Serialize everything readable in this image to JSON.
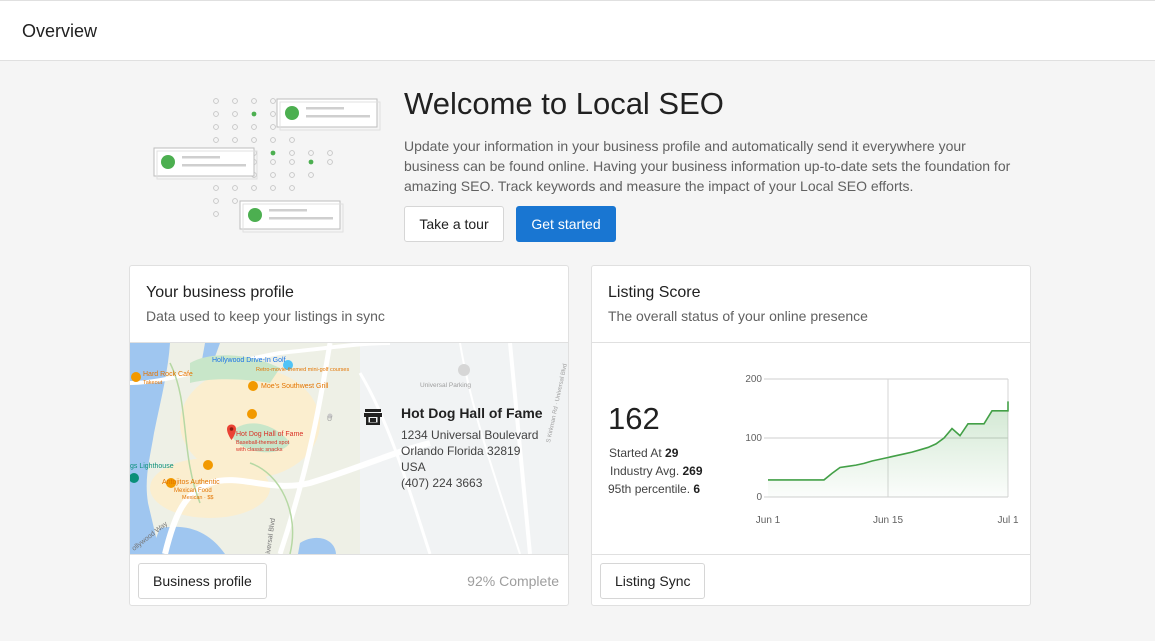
{
  "header": {
    "title": "Overview"
  },
  "welcome": {
    "title": "Welcome to Local SEO",
    "description": "Update your information in your business profile and automatically send it everywhere your business can be found online. Having your business information up-to-date sets the foundation for amazing SEO. Track keywords and measure the impact of your Local SEO efforts.",
    "tour_label": "Take a tour",
    "start_label": "Get started"
  },
  "business_card": {
    "title": "Your business profile",
    "subtitle": "Data used to keep your listings in sync",
    "name": "Hot Dog Hall of Fame",
    "address1": "1234 Universal Boulevard",
    "address2": "Orlando Florida 32819",
    "country": "USA",
    "phone": "(407) 224 3663",
    "button_label": "Business profile",
    "completion": "92% Complete",
    "map_labels": {
      "drive_in": "Hollywood Drive-In Golf",
      "drive_in_sub": "Retro-movie-themed mini-golf courses",
      "hard_rock": "Hard Rock Cafe",
      "hard_rock_sub": "Takeout",
      "moes": "Moe's Southwest Grill",
      "universal_parking": "Universal Parking",
      "pin_title": "Hot Dog Hall of Fame",
      "pin_sub1": "Baseball-themed spot",
      "pin_sub2": "with classic snacks",
      "lighthouse": "gs Lighthouse",
      "antojitos": "Antojitos Authentic",
      "antojitos_sub": "Mexican Food",
      "antojitos_sub2": "Mexican · $$",
      "kirkman": "S Kirkman Rd · Universal Blvd",
      "universal_blvd": "iversal Blvd",
      "hollywood_way": "ollywood Way"
    }
  },
  "score_card": {
    "title": "Listing Score",
    "subtitle": "The overall status of your online presence",
    "score": "162",
    "started_label": "Started At",
    "started_value": "29",
    "industry_label": "Industry Avg.",
    "industry_value": "269",
    "percentile_label": "95th percentile.",
    "percentile_value": "6",
    "button_label": "Listing Sync"
  },
  "chart_data": {
    "type": "area",
    "x_ticks": [
      "Jun 1",
      "Jun 15",
      "Jul 1"
    ],
    "y_ticks": [
      "0",
      "100",
      "200"
    ],
    "ylim": [
      0,
      200
    ],
    "x": [
      0,
      1,
      2,
      3,
      4,
      5,
      6,
      7,
      8,
      9,
      10,
      11,
      12,
      13,
      14,
      15,
      16,
      17,
      18,
      19,
      20,
      21,
      22,
      23,
      24,
      25,
      26,
      27,
      28,
      29,
      30
    ],
    "values": [
      29,
      29,
      29,
      29,
      29,
      29,
      29,
      29,
      40,
      50,
      52,
      54,
      57,
      61,
      64,
      67,
      70,
      73,
      76,
      80,
      84,
      90,
      100,
      116,
      104,
      124,
      124,
      124,
      146,
      146,
      146
    ],
    "last_value": 162,
    "color": "#43a047"
  }
}
